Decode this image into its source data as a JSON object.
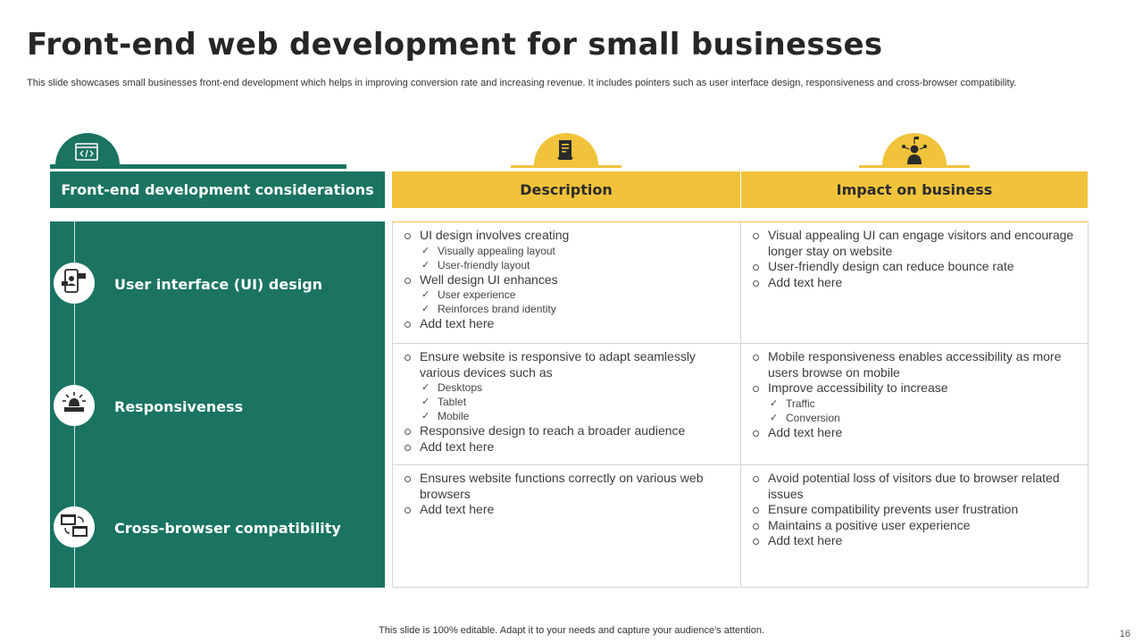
{
  "title": "Front-end web development for small businesses",
  "subtitle": "This slide showcases small businesses front-end development which helps in improving conversion rate and increasing revenue. It includes pointers such as user interface design, responsiveness and cross-browser compatibility.",
  "columns": {
    "considerations": "Front-end development considerations",
    "description": "Description",
    "impact": "Impact on business"
  },
  "colors": {
    "green": "#1a7461",
    "yellow": "#f1c33b"
  },
  "rows": [
    {
      "label": "User interface (UI) design",
      "icon": "mobile-ui-icon",
      "description": [
        {
          "text": "UI design involves creating",
          "sub": [
            "Visually appealing layout",
            "User-friendly  layout"
          ]
        },
        {
          "text": "Well design UI enhances",
          "sub": [
            "User experience",
            "Reinforces  brand  identity"
          ]
        },
        {
          "text": "Add text here",
          "sub": []
        }
      ],
      "impact": [
        {
          "text": "Visual appealing  UI can engage visitors and encourage longer stay on website",
          "sub": []
        },
        {
          "text": "User-friendly design can reduce bounce rate",
          "sub": []
        },
        {
          "text": "Add text here",
          "sub": []
        }
      ]
    },
    {
      "label": "Responsiveness",
      "icon": "alert-laptop-icon",
      "description": [
        {
          "text": "Ensure website is responsive to adapt seamlessly various devices such as",
          "sub": [
            "Desktops",
            "Tablet",
            "Mobile"
          ]
        },
        {
          "text": "Responsive design to reach a broader audience",
          "sub": []
        },
        {
          "text": "Add text here",
          "sub": []
        }
      ],
      "impact": [
        {
          "text": "Mobile responsiveness enables accessibility as more users browse on mobile",
          "sub": []
        },
        {
          "text": "Improve accessibility to increase",
          "sub": [
            "Traffic",
            "Conversion"
          ]
        },
        {
          "text": "Add text here",
          "sub": []
        }
      ]
    },
    {
      "label": "Cross-browser compatibility",
      "icon": "browser-windows-icon",
      "description": [
        {
          "text": "Ensures website functions correctly on various web browsers",
          "sub": []
        },
        {
          "text": "Add text here",
          "sub": []
        }
      ],
      "impact": [
        {
          "text": "Avoid  potential loss of visitors due to browser related issues",
          "sub": []
        },
        {
          "text": "Ensure compatibility prevents user frustration",
          "sub": []
        },
        {
          "text": "Maintains  a positive user experience",
          "sub": []
        },
        {
          "text": "Add text here",
          "sub": []
        }
      ]
    }
  ],
  "footer": "This slide is 100% editable. Adapt it to your needs and capture your audience's attention.",
  "page_number": "16"
}
